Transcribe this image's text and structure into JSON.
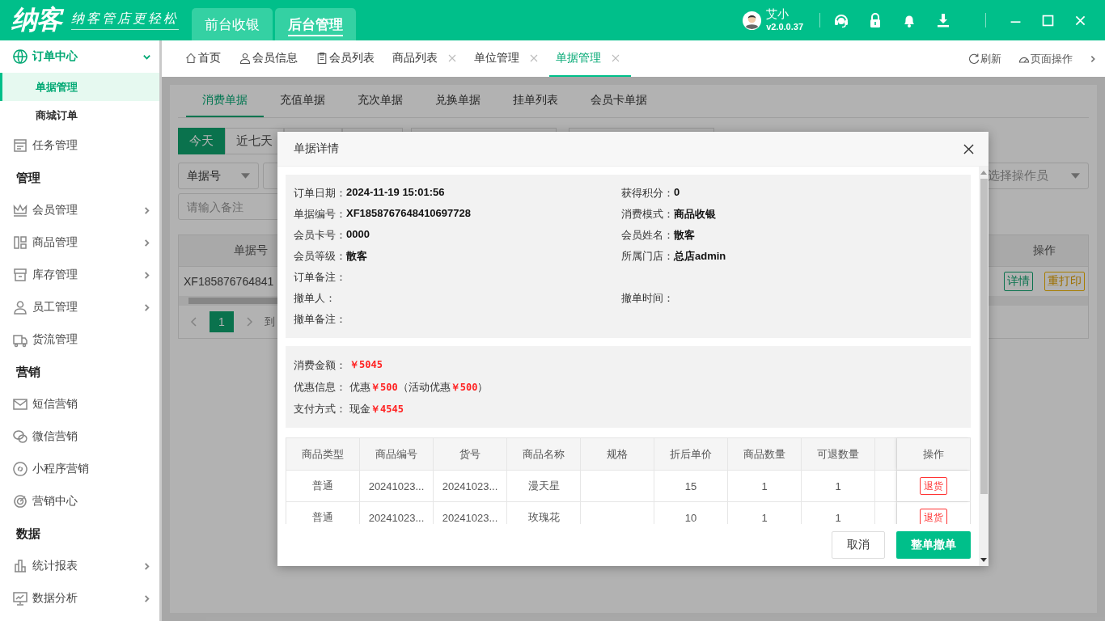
{
  "app": {
    "logo": "纳客",
    "slogan": "纳客管店更轻松",
    "modes": [
      {
        "label": "前台收银",
        "selected": false
      },
      {
        "label": "后台管理",
        "selected": true
      }
    ],
    "user": {
      "name": "艾小",
      "version": "v2.0.0.37"
    }
  },
  "sidebar": {
    "items": [
      {
        "kind": "group",
        "label": "订单中心",
        "expanded": true,
        "children": [
          {
            "label": "单据管理",
            "selected": true
          },
          {
            "label": "商城订单",
            "selected": false
          }
        ]
      },
      {
        "kind": "item",
        "label": "任务管理"
      },
      {
        "kind": "heading",
        "label": "管理"
      },
      {
        "kind": "item",
        "label": "会员管理",
        "expanded": false
      },
      {
        "kind": "item",
        "label": "商品管理",
        "expanded": false
      },
      {
        "kind": "item",
        "label": "库存管理",
        "expanded": false
      },
      {
        "kind": "item",
        "label": "员工管理",
        "expanded": false
      },
      {
        "kind": "item",
        "label": "货流管理"
      },
      {
        "kind": "heading",
        "label": "营销"
      },
      {
        "kind": "item",
        "label": "短信营销"
      },
      {
        "kind": "item",
        "label": "微信营销"
      },
      {
        "kind": "item",
        "label": "小程序营销"
      },
      {
        "kind": "item",
        "label": "营销中心"
      },
      {
        "kind": "heading",
        "label": "数据"
      },
      {
        "kind": "item",
        "label": "统计报表",
        "expanded": false
      },
      {
        "kind": "item",
        "label": "数据分析",
        "expanded": false
      }
    ]
  },
  "page_tabs": [
    {
      "label": "首页",
      "closable": false,
      "selected": false
    },
    {
      "label": "会员信息",
      "closable": false,
      "selected": false
    },
    {
      "label": "会员列表",
      "closable": false,
      "selected": false
    },
    {
      "label": "商品列表",
      "closable": true,
      "selected": false
    },
    {
      "label": "单位管理",
      "closable": true,
      "selected": false
    },
    {
      "label": "单据管理",
      "closable": true,
      "selected": true
    }
  ],
  "tab_actions": [
    "刷新",
    "页面操作"
  ],
  "page": {
    "sub_tabs": [
      {
        "label": "消费单据",
        "selected": true
      },
      {
        "label": "充值单据",
        "selected": false
      },
      {
        "label": "充次单据",
        "selected": false
      },
      {
        "label": "兑换单据",
        "selected": false
      },
      {
        "label": "挂单列表",
        "selected": false
      },
      {
        "label": "会员卡单据",
        "selected": false
      }
    ],
    "date_filters": [
      {
        "label": "今天",
        "selected": true
      },
      {
        "label": "近七天",
        "selected": false
      }
    ],
    "filters": {
      "field_select": "单据号",
      "operator_placeholder": "选择操作员",
      "remark_placeholder": "请输入备注"
    },
    "table": {
      "columns": [
        "单据号",
        "操作"
      ],
      "rows": [
        {
          "id": "XF185876764841",
          "actions": [
            "详情",
            "重打印"
          ]
        }
      ]
    },
    "pager": {
      "pages": [
        {
          "label": "1",
          "selected": true
        }
      ],
      "goto": "到"
    }
  },
  "dialog": {
    "title": "单据详情",
    "info_rows": [
      {
        "left": {
          "label": "订单日期：",
          "value": "2024-11-19 15:01:56"
        },
        "right": {
          "label": "获得积分：",
          "value": "0"
        }
      },
      {
        "left": {
          "label": "单据编号：",
          "value": "XF1858767648410697728"
        },
        "right": {
          "label": "消费模式：",
          "value": "商品收银"
        }
      },
      {
        "left": {
          "label": "会员卡号：",
          "value": "0000"
        },
        "right": {
          "label": "会员姓名：",
          "value": "散客"
        }
      },
      {
        "left": {
          "label": "会员等级：",
          "value": "散客"
        },
        "right": {
          "label": "所属门店：",
          "value": "总店admin"
        }
      },
      {
        "left": {
          "label": "订单备注："
        }
      },
      {
        "left": {
          "label": "撤单人："
        },
        "right": {
          "label": "撤单时间："
        }
      },
      {
        "left": {
          "label": "撤单备注："
        }
      }
    ],
    "amounts": [
      {
        "label": "消费金额：",
        "kind": "amount",
        "value": "￥5045"
      },
      {
        "label": "优惠信息：",
        "kind": "detail",
        "value": "优惠**￥500**（活动优惠**￥500**）"
      },
      {
        "label": "支付方式：",
        "kind": "detail",
        "value": "现金**￥4545**"
      }
    ],
    "items_table": {
      "columns": [
        "商品类型",
        "商品编号",
        "货号",
        "商品名称",
        "规格",
        "折后单价",
        "商品数量",
        "可退数量"
      ],
      "action_column": "操作",
      "rows": [
        {
          "type": "普通",
          "code": "20241023...",
          "sku": "20241023...",
          "name": "漫天星",
          "price": "15",
          "qty": "1",
          "returnable": "1",
          "action": "退货"
        },
        {
          "type": "普通",
          "code": "20241023...",
          "sku": "20241023...",
          "name": "玫瑰花",
          "price": "10",
          "qty": "1",
          "returnable": "1",
          "action": "退货"
        }
      ]
    },
    "buttons": [
      {
        "label": "取消",
        "kind": "secondary"
      },
      {
        "label": "整单撤单",
        "kind": "primary"
      }
    ]
  }
}
